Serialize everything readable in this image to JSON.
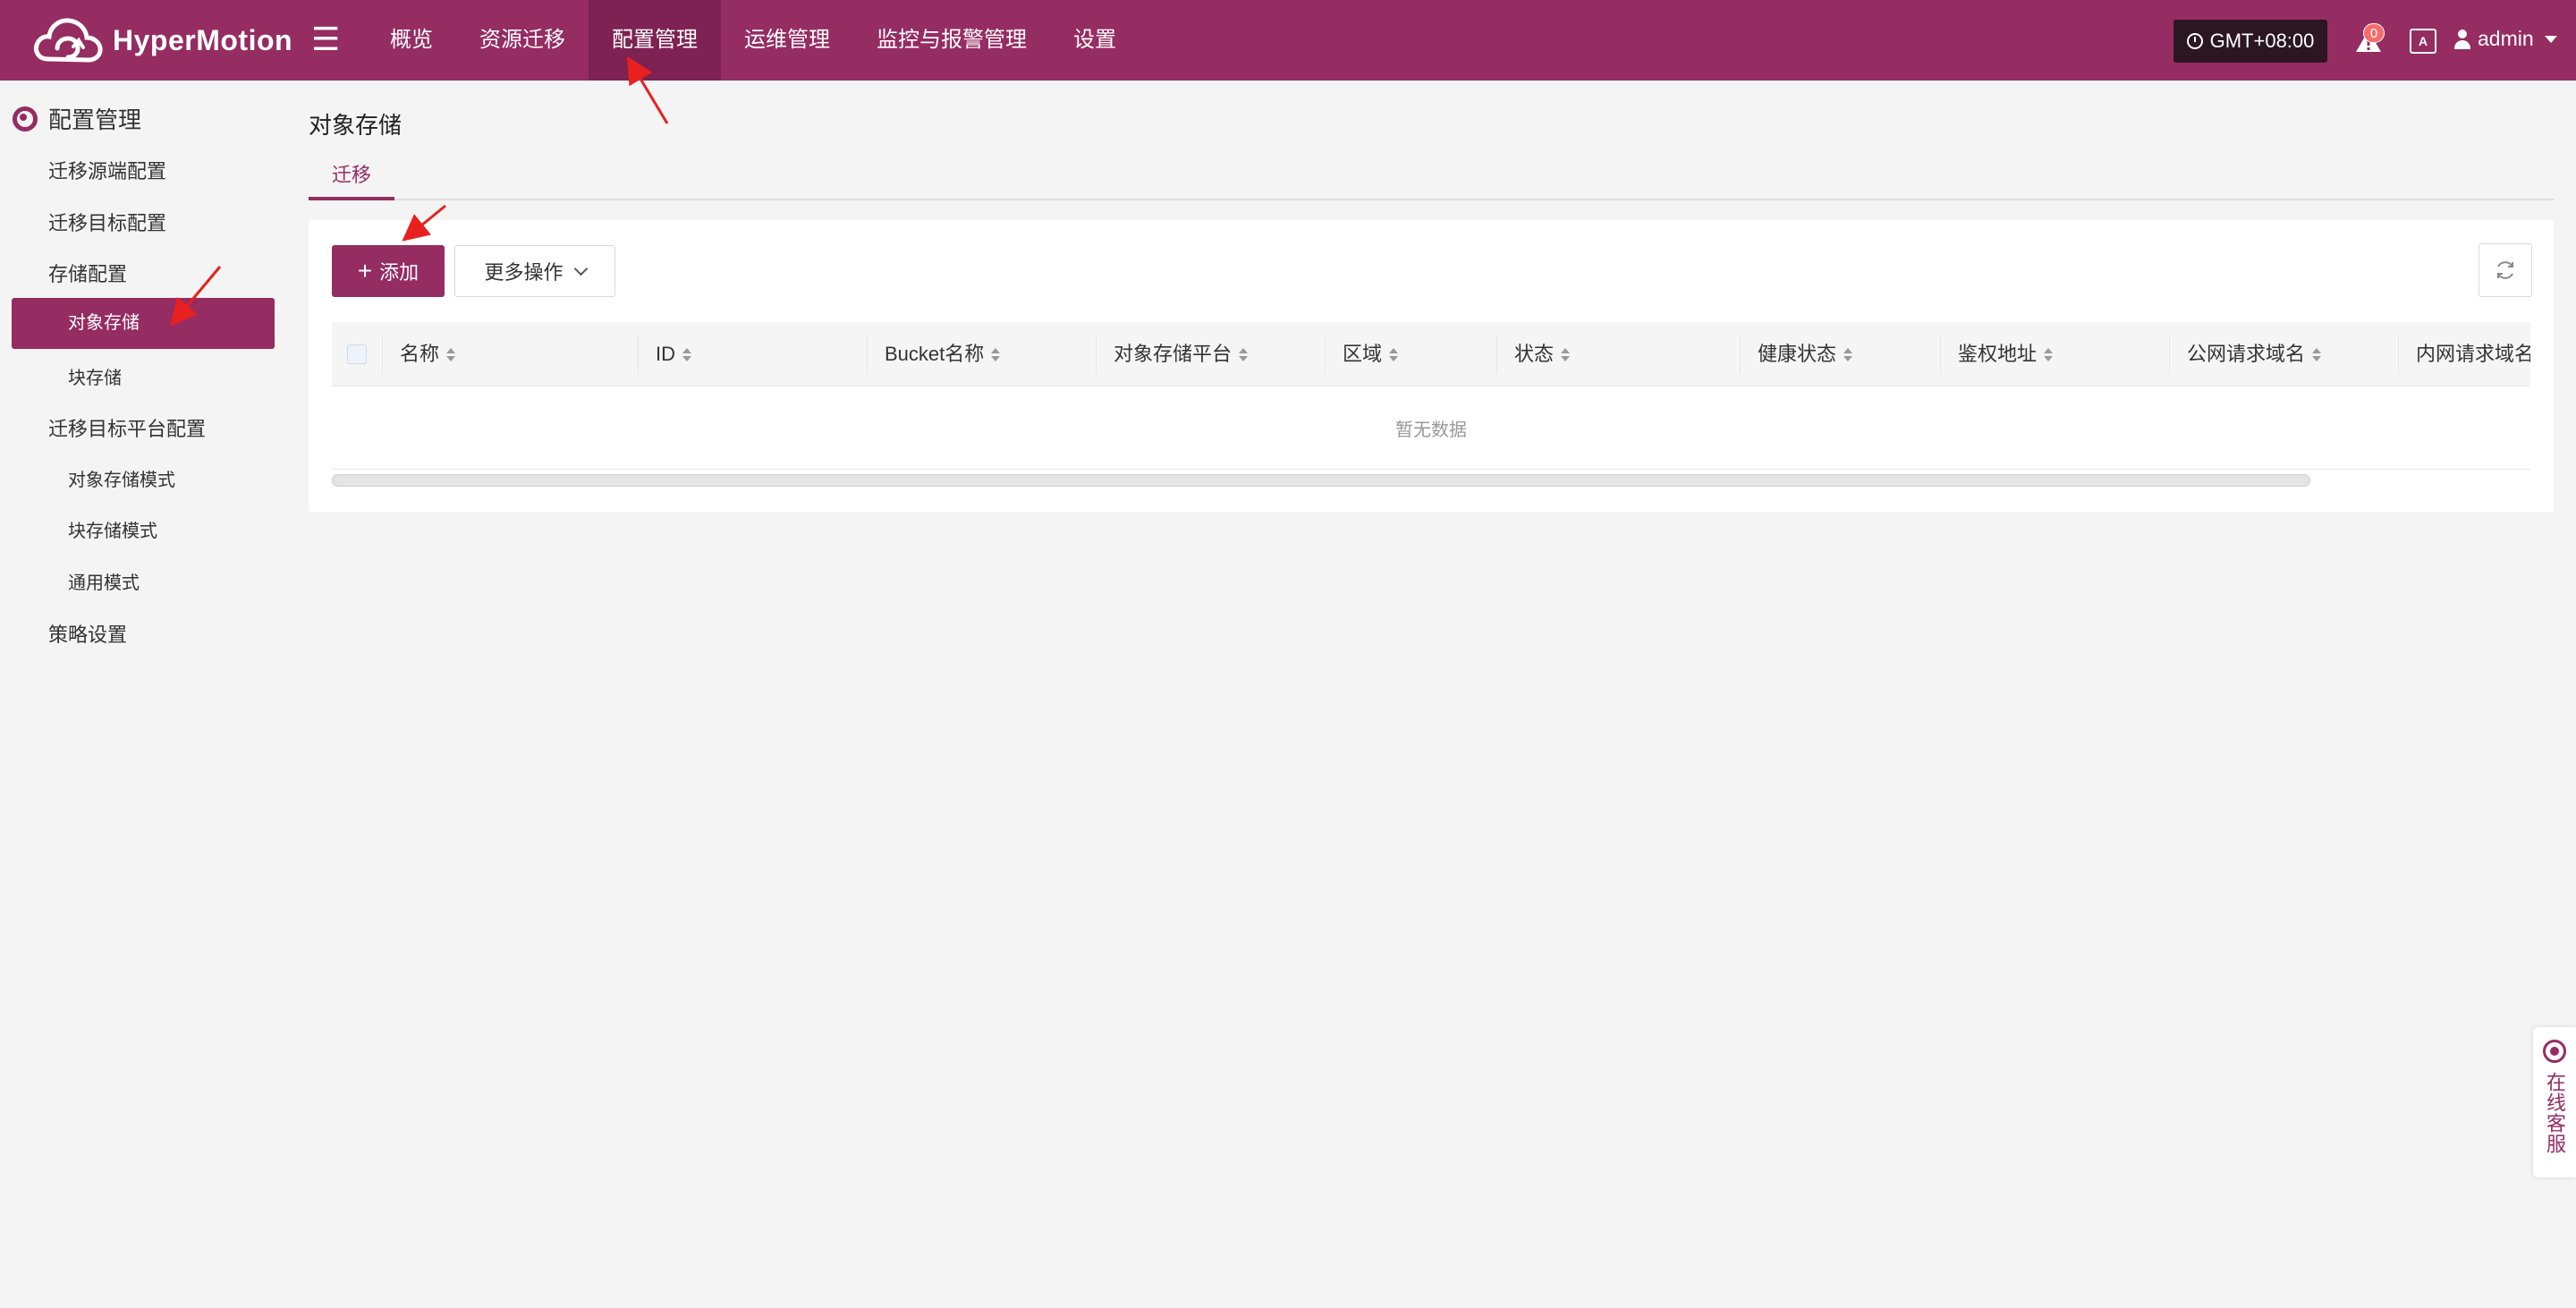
{
  "app": {
    "name": "HyperMotion"
  },
  "nav": {
    "items": [
      {
        "label": "概览"
      },
      {
        "label": "资源迁移"
      },
      {
        "label": "配置管理"
      },
      {
        "label": "运维管理"
      },
      {
        "label": "监控与报警管理"
      },
      {
        "label": "设置"
      }
    ],
    "active_index": 2
  },
  "header": {
    "timezone": "GMT+08:00",
    "alert_count": "0",
    "lang_label": "A",
    "user": "admin"
  },
  "sidebar": {
    "section_title": "配置管理",
    "items": [
      {
        "label": "迁移源端配置"
      },
      {
        "label": "迁移目标配置"
      },
      {
        "label": "存储配置"
      },
      {
        "label": "对象存储"
      },
      {
        "label": "块存储"
      },
      {
        "label": "迁移目标平台配置"
      },
      {
        "label": "对象存储模式"
      },
      {
        "label": "块存储模式"
      },
      {
        "label": "通用模式"
      },
      {
        "label": "策略设置"
      }
    ],
    "active_label": "对象存储"
  },
  "main": {
    "title": "对象存储",
    "tabs": [
      {
        "label": "迁移"
      }
    ],
    "toolbar": {
      "add_label": "添加",
      "more_label": "更多操作"
    },
    "table": {
      "columns": [
        "名称",
        "ID",
        "Bucket名称",
        "对象存储平台",
        "区域",
        "状态",
        "健康状态",
        "鉴权地址",
        "公网请求域名",
        "内网请求域名"
      ],
      "empty_text": "暂无数据"
    }
  },
  "support": {
    "label": "在线客服"
  },
  "colors": {
    "brand": "#952c62",
    "brand_dark": "#7d2252",
    "annotation_arrow": "#e8201f"
  }
}
